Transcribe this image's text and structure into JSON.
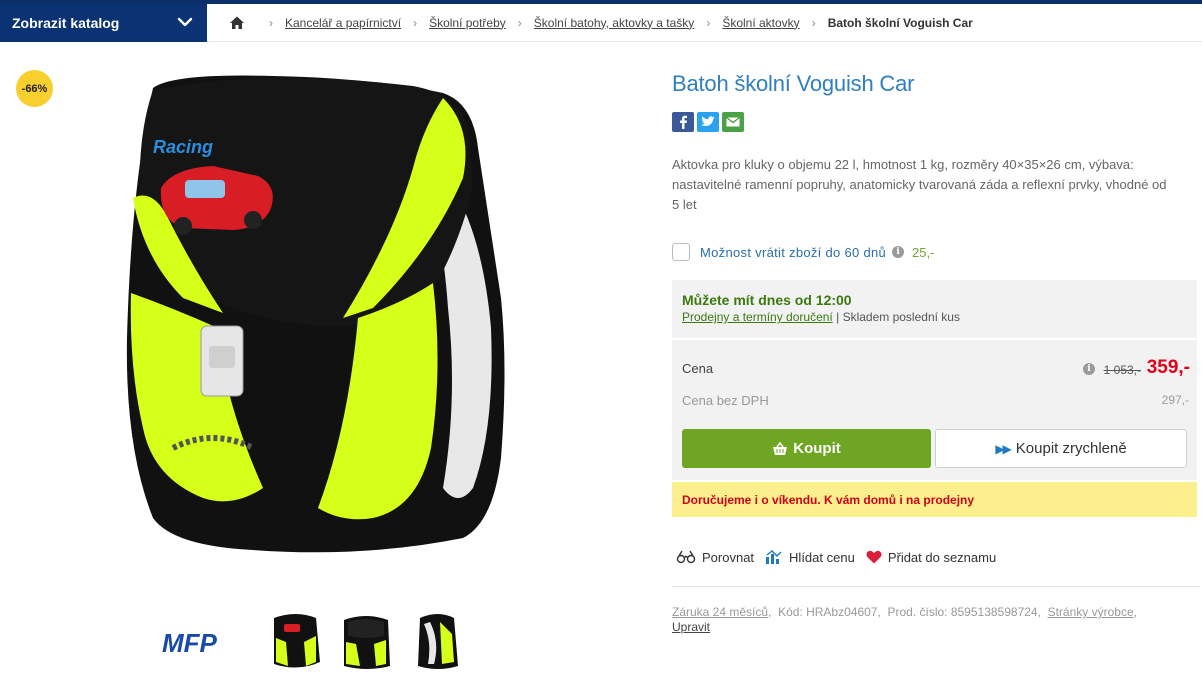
{
  "header": {
    "catalog_button": "Zobrazit katalog",
    "breadcrumb": [
      "Kancelář a papírnictví",
      "Školní potřeby",
      "Školní batohy, aktovky a tašky",
      "Školní aktovky"
    ],
    "breadcrumb_current": "Batoh školní Voguish Car"
  },
  "gallery": {
    "discount_badge": "-66%",
    "brand_logo_text": "MFP",
    "thumbnails": [
      "thumbnail-front",
      "thumbnail-open",
      "thumbnail-side"
    ]
  },
  "product": {
    "title": "Batoh školní Voguish Car",
    "social": [
      "facebook-icon",
      "twitter-icon",
      "email-icon"
    ],
    "description": "Aktovka pro kluky o objemu 22 l, hmotnost 1 kg, rozměry 40×35×26 cm, výbava: nastavitelné ramenní popruhy, anatomicky tvarovaná záda a reflexní prvky, vhodné od 5 let",
    "return_option": {
      "label": "Možnost vrátit zboží do 60 dnů",
      "price": "25,-"
    },
    "delivery": {
      "headline": "Můžete mít dnes od 12:00",
      "link": "Prodejny a termíny doručení",
      "separator": "|",
      "stock": "Skladem poslední kus"
    },
    "pricing": {
      "price_label": "Cena",
      "old_price": "1 053,-",
      "new_price": "359,-",
      "novat_label": "Cena bez DPH",
      "novat_value": "297,-"
    },
    "buttons": {
      "buy": "Koupit",
      "buy_fast": "Koupit zrychleně"
    },
    "weekend_notice": "Doručujeme i o víkendu. K vám domů i na prodejny",
    "actions": {
      "compare": "Porovnat",
      "watch_price": "Hlídat cenu",
      "add_to_list": "Přidat do seznamu"
    },
    "meta": {
      "warranty": "Záruka 24 měsíců",
      "code": "Kód: HRAbz04607,",
      "prod_number": "Prod. číslo: 8595138598724,",
      "manufacturer_pages": "Stránky výrobce",
      "edit": "Upravit"
    }
  },
  "colors": {
    "navy": "#0b3374",
    "title_blue": "#2f7fc1",
    "buy_green": "#6ea623",
    "price_red": "#e3001b",
    "badge_yellow": "#f7cf2e",
    "neon": "#d6ff1a"
  }
}
